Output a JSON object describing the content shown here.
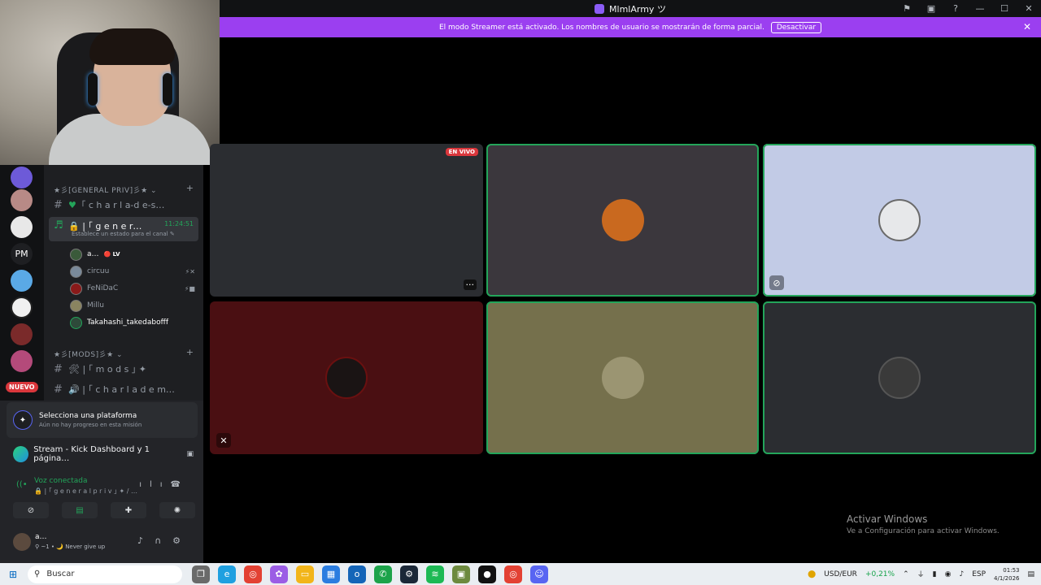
{
  "window": {
    "title": "MlmlArmy ツ",
    "controls": [
      "⚑",
      "▣",
      "?",
      "—",
      "☐",
      "✕"
    ]
  },
  "banner": {
    "text": "El modo Streamer está activado. Los nombres de usuario se mostrarán de forma parcial.",
    "button": "Desactivar",
    "close": "✕"
  },
  "rail": {
    "servers": [
      "",
      "",
      "",
      "PM",
      "",
      "",
      "",
      ""
    ],
    "new_badge": "NUEVO"
  },
  "channels": {
    "cat1": "★彡[GENERAL PRIV]彡★ ⌄",
    "cat1_plus": "+",
    "chan1": "｢ c h a r l a-d e-s…",
    "active_channel": "🔒 | ｢ g e n e r…",
    "active_time": "11:24:51",
    "active_sub": "Establece un estado para el canal ✎",
    "voice_users": [
      {
        "name": "a…",
        "tag": "🔴 LV"
      },
      {
        "name": "circuu",
        "tag": ""
      },
      {
        "name": "FeNiDaC",
        "tag": ""
      },
      {
        "name": "Millu",
        "tag": ""
      },
      {
        "name": "Takahashi_takedabofff",
        "tag": ""
      }
    ],
    "cat2": "★彡[MODS]彡★ ⌄",
    "cat2_plus": "+",
    "chan2": "🛠 | ｢ m o d s ｣ ✦",
    "chan3": "🔊 | ｢ c h a r l a d e m…"
  },
  "panel": {
    "mission_title": "Selecciona una plataforma",
    "mission_sub": "Aún no hay progreso en esta misión",
    "stream_label": "Stream - Kick Dashboard y 1 página…",
    "voice_title": "Voz conectada",
    "voice_sub": "🔒 | ｢ g e n e r a l p r i v ｣ ✦ / …",
    "user_name": "a…",
    "user_status": "⚲ ~1 • 🌙 Never give up"
  },
  "grid": {
    "live_badge": "EN VIVO",
    "more": "···",
    "colors": {
      "tile1": "#2b2d31",
      "tile2": "#3b373d",
      "tile3": "#c2cbe6",
      "tile4": "#4a0f12",
      "tile5": "#75704c",
      "tile6": "#2b2d31",
      "speaking": "#23a55a"
    }
  },
  "activation": {
    "title": "Activar Windows",
    "sub": "Ve a Configuración para activar Windows."
  },
  "taskbar": {
    "search": "Buscar",
    "currency": "USD/EUR",
    "change": "+0,21%",
    "lang": "ESP",
    "time": "01:53",
    "date": "4/1/2026"
  }
}
